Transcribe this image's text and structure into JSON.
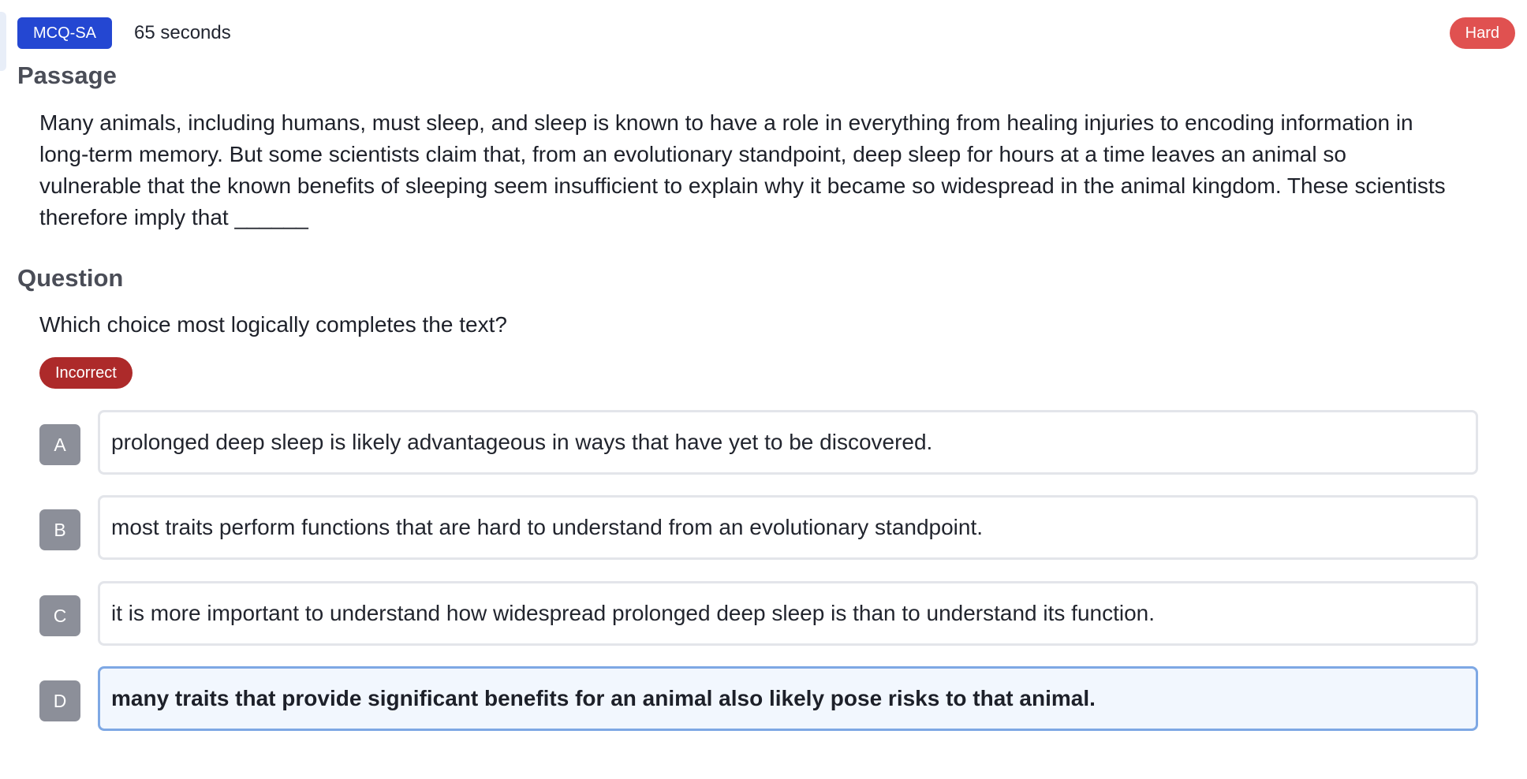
{
  "header": {
    "question_type": "MCQ-SA",
    "time": "65 seconds",
    "difficulty": "Hard"
  },
  "passage": {
    "heading": "Passage",
    "text": "Many animals, including humans, must sleep, and sleep is known to have a role in everything from healing injuries to encoding information in long-term memory. But some scientists claim that, from an evolutionary standpoint, deep sleep for hours at a time leaves an animal so vulnerable that the known benefits of sleeping seem insufficient to explain why it became so widespread in the animal kingdom. These scientists therefore imply that ______"
  },
  "question": {
    "heading": "Question",
    "text": "Which choice most logically completes the text?",
    "result": "Incorrect"
  },
  "choices": [
    {
      "letter": "A",
      "text": "prolonged deep sleep is likely advantageous in ways that have yet to be discovered."
    },
    {
      "letter": "B",
      "text": "most traits perform functions that are hard to understand from an evolutionary standpoint."
    },
    {
      "letter": "C",
      "text": "it is more important to understand how widespread prolonged deep sleep is than to understand its function."
    },
    {
      "letter": "D",
      "text": "many traits that provide significant benefits for an animal also likely pose risks to that animal."
    }
  ],
  "selected_choice": "D",
  "colors": {
    "type_badge": "#2447d2",
    "difficulty_badge": "#e05150",
    "result_badge": "#ad2a2a",
    "letter_badge": "#8c8f99",
    "selected_border": "#7ea8e4",
    "selected_background": "#f2f7fe"
  }
}
